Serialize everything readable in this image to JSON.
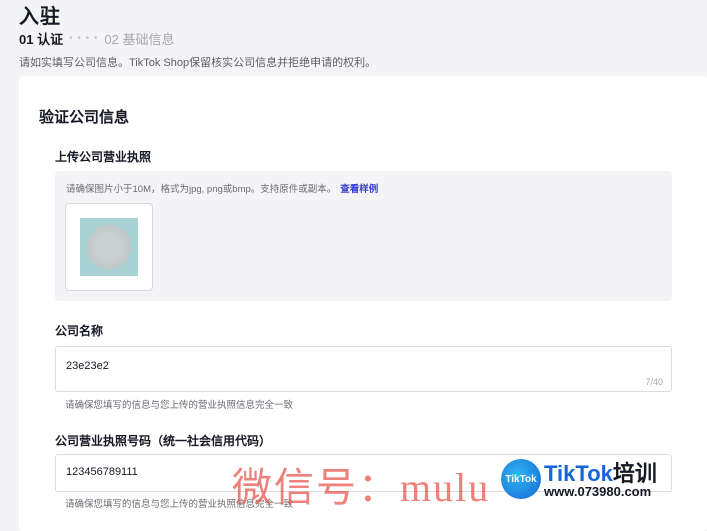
{
  "page": {
    "title": "入驻",
    "steps": [
      {
        "label": "01 认证",
        "active": true
      },
      {
        "label": "02 基础信息",
        "active": false
      }
    ],
    "intro": "请如实填写公司信息。TikTok Shop保留核实公司信息并拒绝申请的权利。"
  },
  "card": {
    "title": "验证公司信息",
    "upload": {
      "label": "上传公司营业执照",
      "hint": "请确保图片小于10M，格式为jpg, png或bmp。支持原件或副本。",
      "link": "查看样例"
    },
    "company_name": {
      "label": "公司名称",
      "value": "23e23e2",
      "counter": "7/40",
      "help": "请确保您填写的信息与您上传的营业执照信息完全一致"
    },
    "license_number": {
      "label": "公司营业执照号码（统一社会信用代码）",
      "value": "123456789111",
      "help": "请确保您填写的信息与您上传的营业执照信息完全一致"
    }
  },
  "watermark": {
    "text": "微信号：mulu",
    "logo_badge": "TikTok",
    "logo_brand": "TikTok",
    "logo_brand_cn": "培训",
    "logo_url": "www.073980.com"
  },
  "colors": {
    "accent": "#3b41d4",
    "background": "#f4f4f6",
    "watermark": "#e8574f"
  }
}
